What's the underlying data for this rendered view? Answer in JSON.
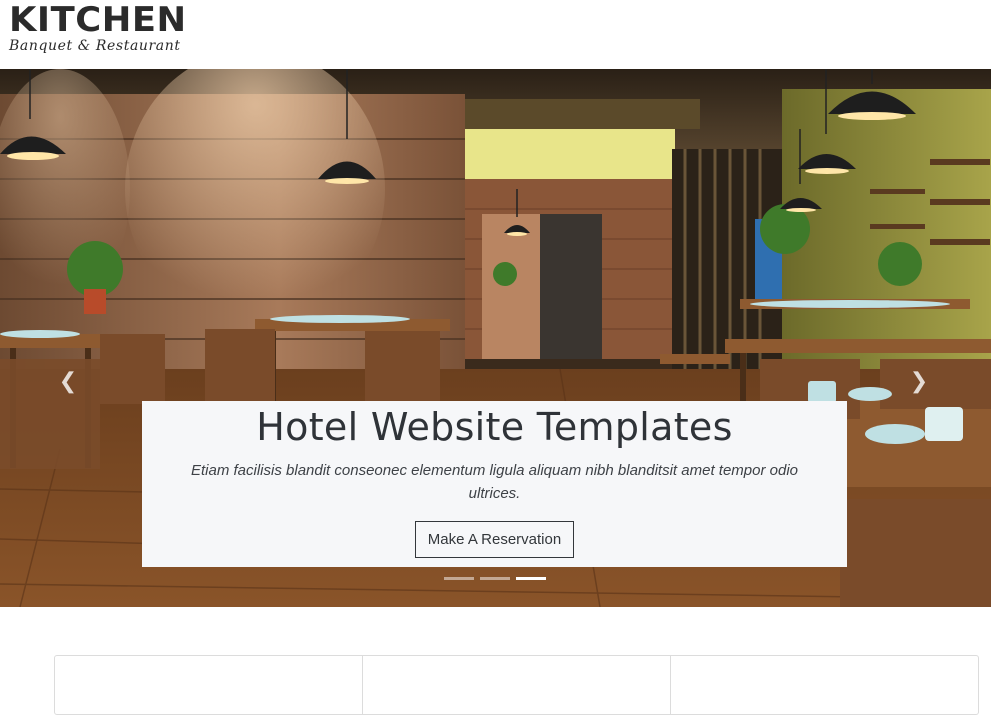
{
  "brand": {
    "name": "KITCHEN",
    "tagline": "Banquet & Restaurant"
  },
  "hero": {
    "slides_count": 3,
    "active_slide": 3,
    "caption": {
      "title": "Hotel Website Templates",
      "text": "Etiam facilisis blandit conseonec elementum ligula aliquam nibh blanditsit amet tempor odio ultrices.",
      "button_label": "Make A Reservation"
    },
    "prev_icon": "chevron-left-icon",
    "next_icon": "chevron-right-icon"
  },
  "colors": {
    "caption_bg": "#f6f7f9",
    "text_dark": "#2f3338",
    "card_border": "#dcdcdc"
  }
}
